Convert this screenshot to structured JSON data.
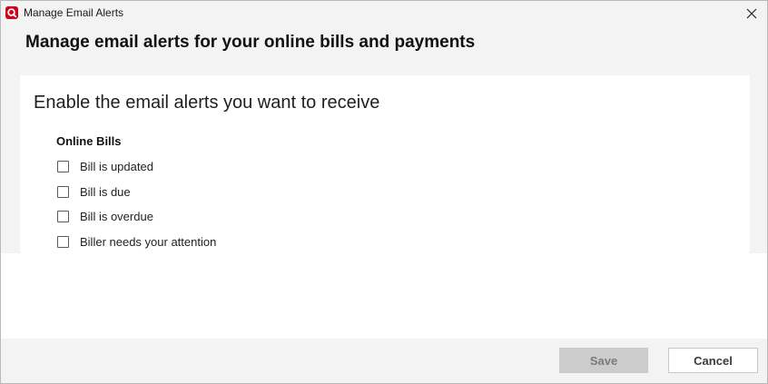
{
  "window": {
    "title": "Manage Email Alerts",
    "app_icon": "q-logo-icon",
    "close_icon": "close-icon"
  },
  "header": {
    "title": "Manage email alerts for your online bills and payments"
  },
  "panel": {
    "subtitle": "Enable the email alerts you want to receive",
    "section_label": "Online Bills",
    "options": [
      {
        "label": "Bill is updated",
        "checked": false
      },
      {
        "label": "Bill is due",
        "checked": false
      },
      {
        "label": "Bill is overdue",
        "checked": false
      },
      {
        "label": "Biller needs your attention",
        "checked": false
      }
    ]
  },
  "footer": {
    "save_label": "Save",
    "save_enabled": false,
    "cancel_label": "Cancel"
  },
  "colors": {
    "brand": "#d0021b",
    "chrome_bg": "#f3f3f3",
    "disabled_button_bg": "#cccccc"
  }
}
